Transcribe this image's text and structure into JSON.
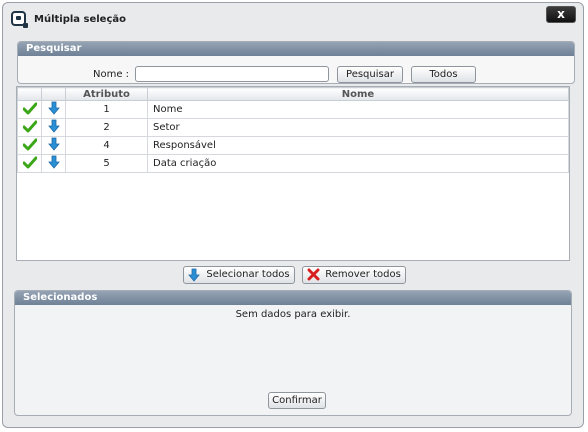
{
  "window": {
    "title": "Múltipla seleção",
    "close_label": "x"
  },
  "search": {
    "header": "Pesquisar",
    "name_label": "Nome :",
    "name_value": "",
    "search_button": "Pesquisar",
    "all_button": "Todos"
  },
  "grid": {
    "columns": [
      "Atributo",
      "Nome"
    ],
    "rows": [
      {
        "atributo": "1",
        "nome": "Nome"
      },
      {
        "atributo": "2",
        "nome": "Setor"
      },
      {
        "atributo": "4",
        "nome": "Responsável"
      },
      {
        "atributo": "5",
        "nome": "Data criação"
      }
    ]
  },
  "actions": {
    "select_all": "Selecionar todos",
    "remove_all": "Remover todos"
  },
  "selected": {
    "header": "Selecionados",
    "empty_text": "Sem dados para exibir.",
    "confirm_button": "Confirmar"
  },
  "icons": {
    "app": "app-logo-icon",
    "row_check": "checkmark-icon",
    "row_move": "arrow-down-icon",
    "remove": "red-x-icon"
  },
  "colors": {
    "check": "#3aa618",
    "arrow": "#2b8fd6",
    "remove": "#d81f1f",
    "header": "#7b8b9e"
  }
}
